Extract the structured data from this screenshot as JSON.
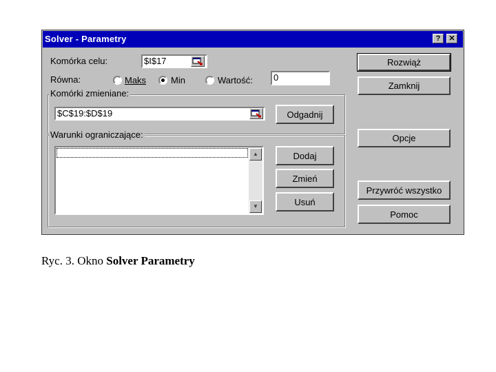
{
  "dialog": {
    "title": "Solver - Parametry",
    "help_glyph": "?",
    "close_glyph": "✕",
    "target_cell_label": "Komórka celu:",
    "target_cell_value": "$I$17",
    "equal_to_label": "Równa:",
    "radio_max": "Maks",
    "radio_min": "Min",
    "radio_value": "Wartość:",
    "selected_option": "Min",
    "value_field": "0",
    "changing_cells_legend": "Komórki zmieniane:",
    "changing_cells_value": "$C$19:$D$19",
    "guess_button": "Odgadnij",
    "constraints_legend": "Warunki ograniczające:",
    "constraints": [],
    "add_button": "Dodaj",
    "change_button": "Zmień",
    "delete_button": "Usuń",
    "solve_button": "Rozwiąż",
    "close_button": "Zamknij",
    "options_button": "Opcje",
    "reset_all_button": "Przywróć wszystko",
    "help_button": "Pomoc"
  },
  "caption": {
    "prefix": "Ryc. 3. Okno ",
    "bold": "Solver Parametry"
  }
}
